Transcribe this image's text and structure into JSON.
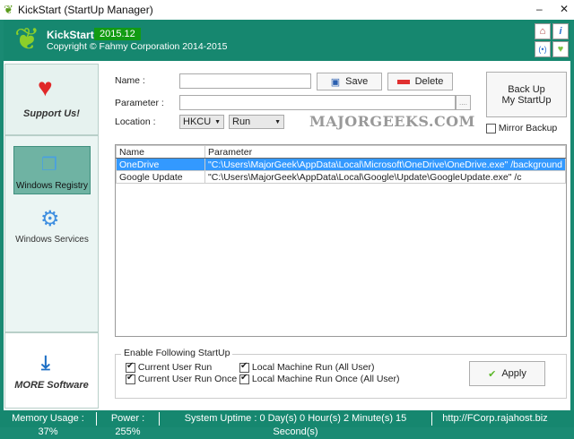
{
  "window": {
    "title": "KickStart (StartUp Manager)",
    "minimize": "–",
    "close": "✕"
  },
  "header": {
    "app_name": "KickStart",
    "version": "2015.12",
    "copyright": "Copyright © Fahmy Corporation 2014-2015"
  },
  "sidebar": {
    "support": "Support Us!",
    "registry": "Windows Registry",
    "services": "Windows Services",
    "more": "MORE Software"
  },
  "form": {
    "name_label": "Name :",
    "name_value": "",
    "parameter_label": "Parameter :",
    "parameter_value": "",
    "browse": "....",
    "location_label": "Location :",
    "hive": "HKCU",
    "key": "Run",
    "save": "Save",
    "delete": "Delete",
    "backup_line1": "Back Up",
    "backup_line2": "My StartUp",
    "mirror_backup": "Mirror Backup",
    "watermark": "MAJORGEEKS.COM"
  },
  "table": {
    "columns": [
      "Name",
      "Parameter"
    ],
    "rows": [
      {
        "name": "OneDrive",
        "parameter": "\"C:\\Users\\MajorGeek\\AppData\\Local\\Microsoft\\OneDrive\\OneDrive.exe\" /background"
      },
      {
        "name": "Google Update",
        "parameter": "\"C:\\Users\\MajorGeek\\AppData\\Local\\Google\\Update\\GoogleUpdate.exe\" /c"
      }
    ]
  },
  "enable": {
    "title": "Enable Following StartUp",
    "items": [
      "Current User Run",
      "Current User Run Once",
      "Local Machine Run (All User)",
      "Local Machine Run Once (All User)"
    ],
    "apply": "Apply"
  },
  "status": {
    "memory": "Memory Usage : 37%",
    "power": "Power : 255%",
    "uptime": "System Uptime : 0 Day(s) 0 Hour(s) 2 Minute(s) 15 Second(s)",
    "url": "http://FCorp.rajahost.biz"
  }
}
